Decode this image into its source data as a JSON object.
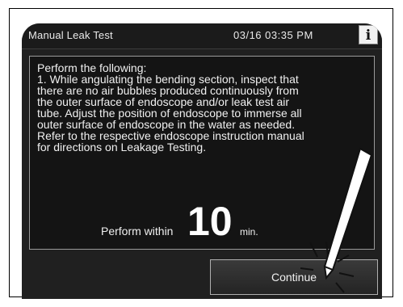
{
  "header": {
    "title": "Manual Leak Test",
    "datetime": "03/16 03:35 PM",
    "info_icon": "info-icon",
    "info_glyph": "i"
  },
  "instructions": {
    "text": "Perform the following:\n1. While angulating the bending section, inspect that\nthere are no air bubbles produced continuously from\nthe outer surface of endoscope and/or leak test air\ntube. Adjust the position of endoscope to immerse all\nouter surface of endoscope in the water as needed.\nRefer to the respective endoscope instruction manual\nfor directions on Leakage Testing."
  },
  "timer": {
    "label": "Perform within",
    "value": "10",
    "unit": "min."
  },
  "actions": {
    "continue_label": "Continue"
  },
  "overlay": {
    "stylus_icon": "stylus-pointer-icon"
  }
}
